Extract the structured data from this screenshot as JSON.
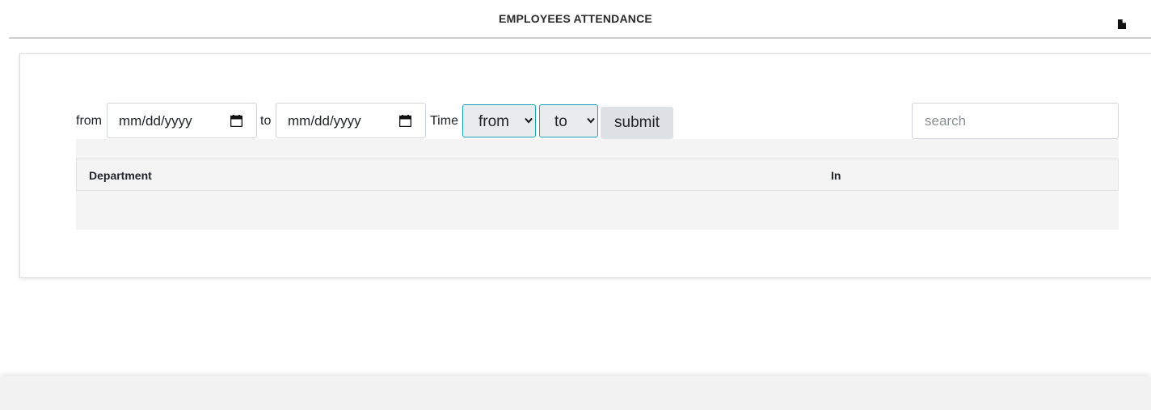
{
  "header": {
    "title": "EMPLOYEES ATTENDANCE",
    "export_icon": "document-icon"
  },
  "filters": {
    "from_label": "from",
    "from_date_value": "mm/dd/yyyy",
    "to_label": "to",
    "to_date_value": "mm/dd/yyyy",
    "time_label": "Time",
    "time_from_selected": "from",
    "time_to_selected": "to",
    "submit_label": "submit"
  },
  "search": {
    "placeholder": "search",
    "value": ""
  },
  "table": {
    "columns": [
      "Department",
      "In"
    ],
    "rows": []
  },
  "colors": {
    "select_border": "#17a2b8",
    "submit_bg": "#dee2e6",
    "table_bg": "#f4f4f4"
  }
}
